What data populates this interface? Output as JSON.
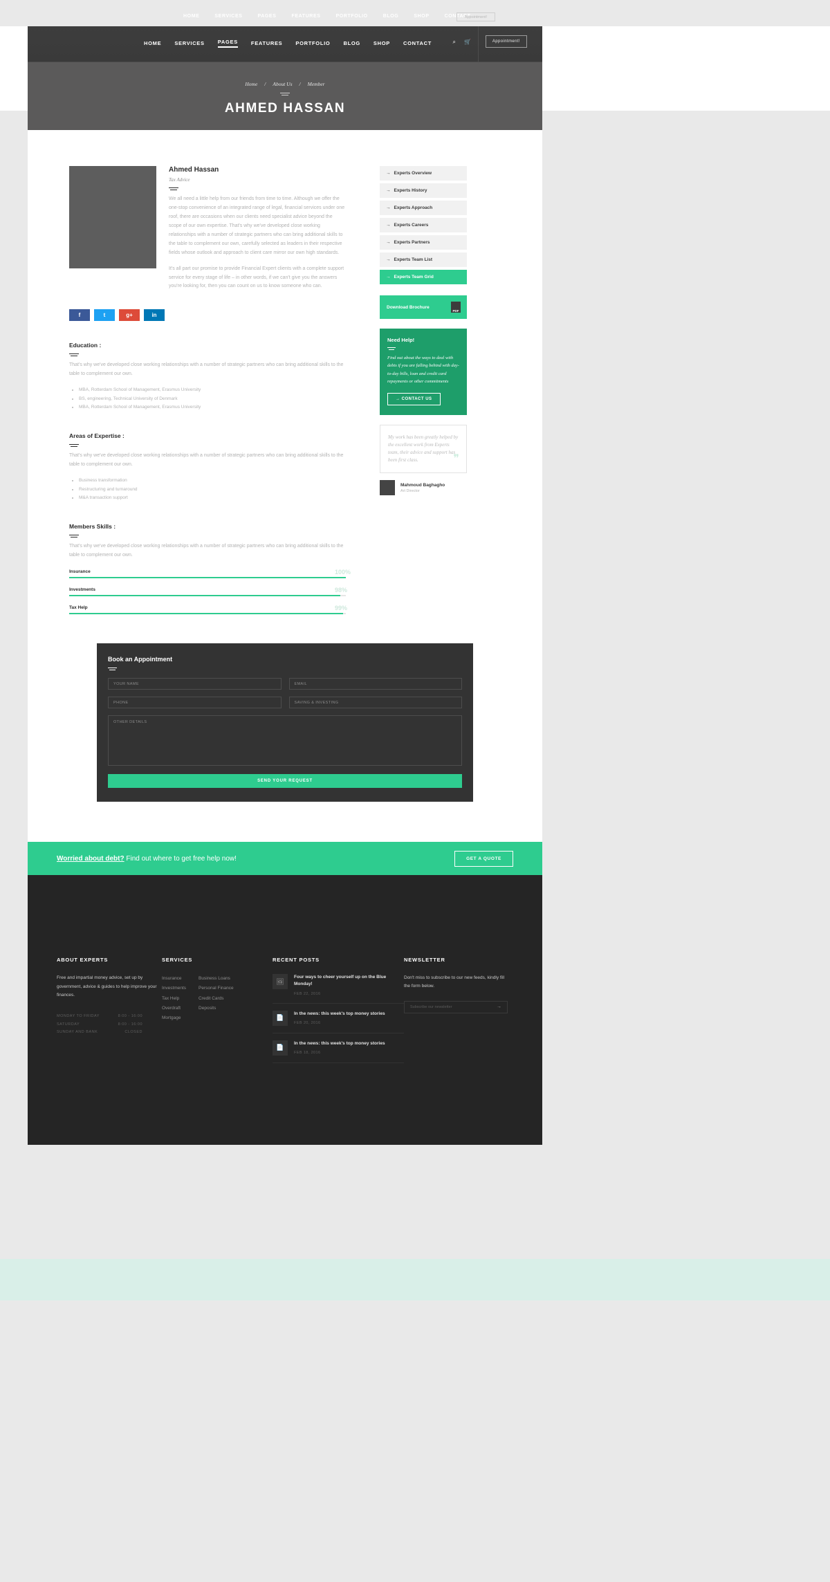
{
  "ghost_nav": {
    "items": [
      "HOME",
      "SERVICES",
      "PAGES",
      "FEATURES",
      "PORTFOLIO",
      "BLOG",
      "SHOP",
      "CONTACT"
    ],
    "button": "Appointment!"
  },
  "header": {
    "nav": [
      {
        "label": "HOME",
        "active": false
      },
      {
        "label": "SERVICES",
        "active": false
      },
      {
        "label": "PAGES",
        "active": true
      },
      {
        "label": "FEATURES",
        "active": false
      },
      {
        "label": "PORTFOLIO",
        "active": false
      },
      {
        "label": "BLOG",
        "active": false
      },
      {
        "label": "SHOP",
        "active": false
      },
      {
        "label": "CONTACT",
        "active": false
      }
    ],
    "search_icon": "search-icon",
    "cart_icon": "cart-icon",
    "appointment_button": "Appointment!"
  },
  "hero": {
    "breadcrumb": [
      "Home",
      "About Us",
      "Member"
    ],
    "separator": "/",
    "title": "AHMED HASSAN"
  },
  "profile": {
    "name": "Ahmed Hassan",
    "role": "Tax Advice",
    "paragraph1": "We all need a little help from our friends from time to time. Although we offer the one-stop convenience of an integrated range of legal, financial services under one roof, there are occasions when our clients need specialist advice beyond the scope of our own expertise. That's why we've developed close working relationships with a number of strategic partners who can bring additional skills to the table to complement our own, carefully selected as leaders in their respective fields whose outlook and approach to client care mirror our own high standards.",
    "paragraph2": "It's all part our promise to provide Financial Expert clients with a complete support service for every stage of life – in other words, if we can't give you the answers you're looking for, then you can count on us to know someone who can.",
    "socials": [
      {
        "name": "facebook",
        "glyph": "f"
      },
      {
        "name": "twitter",
        "glyph": "t"
      },
      {
        "name": "google-plus",
        "glyph": "g+"
      },
      {
        "name": "linkedin",
        "glyph": "in"
      }
    ]
  },
  "sections": [
    {
      "title": "Education :",
      "intro": "That's why we've developed close working relationships with a number of strategic partners who can bring additional skills to the table to complement our own.",
      "items": [
        "MBA, Rotterdam School of Management, Erasmus University",
        "BS, engineering, Technical University of Denmark",
        "MBA, Rotterdam School of Management, Erasmus University"
      ]
    },
    {
      "title": "Areas of Expertise :",
      "intro": "That's why we've developed close working relationships with a number of strategic partners who can bring additional skills to the table to complement our own.",
      "items": [
        "Business transformation",
        "Restructuring and turnaround",
        "M&A transaction support"
      ]
    }
  ],
  "skills_section": {
    "title": "Members Skills :",
    "intro": "That's why we've developed close working relationships with a number of strategic partners who can bring additional skills to the table to complement our own.",
    "skills": [
      {
        "name": "Insurance",
        "percent": "100%",
        "value": 100
      },
      {
        "name": "Investments",
        "percent": "98%",
        "value": 98
      },
      {
        "name": "Tax Help",
        "percent": "99%",
        "value": 99
      }
    ]
  },
  "sidebar": {
    "menu": [
      {
        "label": "Experts Overview",
        "active": false
      },
      {
        "label": "Experts History",
        "active": false
      },
      {
        "label": "Experts Approach",
        "active": false
      },
      {
        "label": "Experts Careers",
        "active": false
      },
      {
        "label": "Experts Partners",
        "active": false
      },
      {
        "label": "Experts Team List",
        "active": false
      },
      {
        "label": "Experts Team Grid",
        "active": true
      }
    ],
    "arrow": "→",
    "brochure": {
      "label": "Download Brochure",
      "icon": "pdf-icon",
      "icon_text": "PDF"
    },
    "need_help": {
      "title": "Need Help!",
      "text": "Find out about the ways to deal with debts if you are falling behind with day-to-day bills, loan and credit card repayments or other commitments",
      "cta": "→  CONTACT US"
    },
    "testimonial": {
      "quote": "My work has been greatly helped by the excellent work from Experts team, their advice and support has been first class.",
      "author": "Mahmoud Baghagho",
      "author_role": "Art Director",
      "quote_mark": "❞"
    }
  },
  "appointment": {
    "title": "Book an Appointment",
    "fields": [
      {
        "name": "your-name",
        "placeholder": "YOUR NAME",
        "value": ""
      },
      {
        "name": "email",
        "placeholder": "EMAIL",
        "value": ""
      },
      {
        "name": "phone",
        "placeholder": "PHONE",
        "value": ""
      },
      {
        "name": "subject",
        "placeholder": "SAVING & INVESTING",
        "value": ""
      }
    ],
    "textarea_placeholder": "OTHER DETAILS",
    "submit": "SEND YOUR REQUEST"
  },
  "debt_cta": {
    "bold": "Worried about debt?",
    "rest": " Find out where to get free help now!",
    "button": "GET A QUOTE"
  },
  "footer": {
    "about": {
      "heading": "ABOUT EXPERTS",
      "text": "Free and impartial money advice, set up by government, advice & guides to help improve your finances.",
      "hours": [
        {
          "day": "MONDAY TO FRIDAY",
          "time": "8:00 - 16:00"
        },
        {
          "day": "SATURDAY",
          "time": "8:00 - 16:00"
        },
        {
          "day": "SUNDAY AND BANK",
          "time": "CLOSED"
        }
      ]
    },
    "services": {
      "heading": "SERVICES",
      "col1": [
        "Insurance",
        "Investments",
        "Tax Help",
        "Overdraft",
        "Mortgage"
      ],
      "col2": [
        "Business Loans",
        "Personal Finance",
        "Credit Cards",
        "Deposits"
      ]
    },
    "recent_posts": {
      "heading": "RECENT POSTS",
      "posts": [
        {
          "title": "Four ways to cheer yourself up on the Blue Monday!",
          "date": "FEB 22, 2016",
          "icon": "image-icon",
          "glyph": "🖼"
        },
        {
          "title": "In the news: this week's top money stories",
          "date": "FEB 20, 2016",
          "icon": "document-icon",
          "glyph": "📄"
        },
        {
          "title": "In the news: this week's top money stories",
          "date": "FEB 18, 2016",
          "icon": "document-icon",
          "glyph": "📄"
        }
      ]
    },
    "newsletter": {
      "heading": "NEWSLETTER",
      "text": "Don't miss to subscribe to our new feeds, kindly fill the form below.",
      "placeholder": "Subscribe our newsletter",
      "submit_icon": "→"
    }
  },
  "colors": {
    "accent": "#2ecc8f",
    "accent_dark": "#1e9e6a",
    "dark": "#333333",
    "footer": "#252525",
    "hero": "#5b5a5a"
  }
}
